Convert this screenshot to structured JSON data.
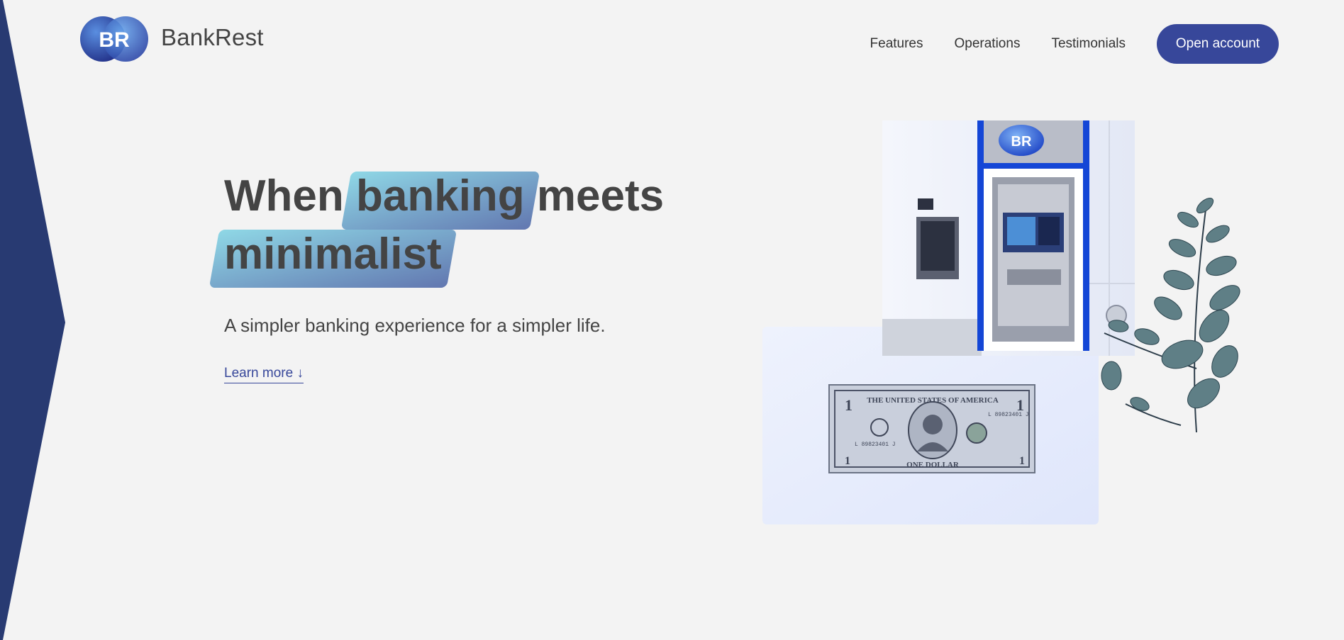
{
  "brand": {
    "logo_text": "BR",
    "name": "BankRest"
  },
  "nav": {
    "links": [
      "Features",
      "Operations",
      "Testimonials"
    ],
    "cta": "Open account"
  },
  "hero": {
    "title_part1": "When",
    "title_highlight1": "banking",
    "title_part2": "meets",
    "title_highlight2": "minimalist",
    "subtitle": "A simpler banking experience for a simpler life.",
    "learn_more": "Learn more ↓"
  },
  "illustration": {
    "atm_logo_text": "BR",
    "bill_header": "THE UNITED STATES OF AMERICA",
    "bill_footer": "ONE DOLLAR",
    "bill_serial": "L 89823401 J",
    "bill_denomination": "1"
  },
  "colors": {
    "accent": "#37479a",
    "side_shape": "#283a72",
    "highlight_start": "#8fd8e6",
    "highlight_end": "#6277b0",
    "background": "#f3f3f3"
  }
}
